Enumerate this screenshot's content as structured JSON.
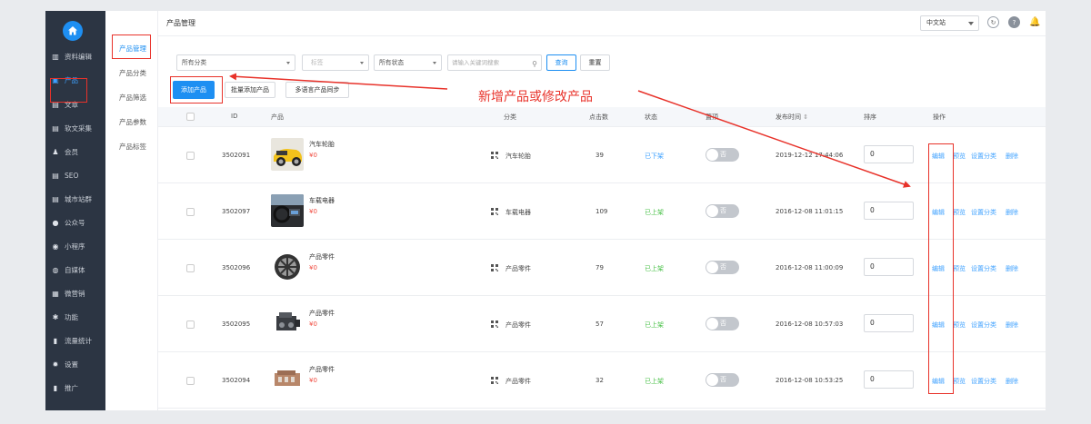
{
  "sidebar": {
    "items": [
      {
        "label": "资料编辑",
        "icon": "columns-icon",
        "active": false
      },
      {
        "label": "产品",
        "icon": "box-icon",
        "active": true
      },
      {
        "label": "文章",
        "icon": "document-icon",
        "active": false
      },
      {
        "label": "软文采集",
        "icon": "document-icon",
        "active": false
      },
      {
        "label": "会员",
        "icon": "users-icon",
        "active": false
      },
      {
        "label": "SEO",
        "icon": "document-icon",
        "active": false
      },
      {
        "label": "城市站群",
        "icon": "document-icon",
        "active": false
      },
      {
        "label": "公众号",
        "icon": "chat-icon",
        "active": false
      },
      {
        "label": "小程序",
        "icon": "compass-icon",
        "active": false
      },
      {
        "label": "自媒体",
        "icon": "media-icon",
        "active": false
      },
      {
        "label": "微营销",
        "icon": "briefcase-icon",
        "active": false
      },
      {
        "label": "功能",
        "icon": "puzzle-icon",
        "active": false
      },
      {
        "label": "流量统计",
        "icon": "bar-chart-icon",
        "active": false
      },
      {
        "label": "设置",
        "icon": "gear-icon",
        "active": false
      },
      {
        "label": "推广",
        "icon": "bar-chart-icon",
        "active": false
      }
    ]
  },
  "subnav": {
    "items": [
      {
        "label": "产品管理",
        "active": true
      },
      {
        "label": "产品分类",
        "active": false
      },
      {
        "label": "产品筛选",
        "active": false
      },
      {
        "label": "产品参数",
        "active": false
      },
      {
        "label": "产品标签",
        "active": false
      }
    ]
  },
  "header": {
    "title": "产品管理",
    "site_select": "中文站"
  },
  "filters": {
    "category": "所有分类",
    "tag": "标签",
    "status": "所有状态",
    "search_placeholder": "请输入关键词搜索",
    "query_label": "查询",
    "reset_label": "重置"
  },
  "actions": {
    "add_label": "添加产品",
    "batch_add_label": "批量添加产品",
    "multilang_label": "多语言产品同步"
  },
  "table": {
    "headers": {
      "id": "ID",
      "product": "产品",
      "category": "分类",
      "clicks": "点击数",
      "status": "状态",
      "top": "置顶",
      "publish_time": "发布时间",
      "sort": "排序",
      "ops": "操作"
    },
    "sort_arrow": "⇕",
    "op_labels": {
      "edit": "编辑",
      "preview": "预览",
      "set_category": "设置分类",
      "delete": "删除"
    },
    "rows": [
      {
        "id": "3502091",
        "name": "汽车轮胎",
        "price": "¥0",
        "category": "汽车轮胎",
        "clicks": "39",
        "status": "已下架",
        "status_type": "off",
        "top": "否",
        "time": "2019-12-12 17:44:06",
        "sort": "0",
        "thumb": "yellow-car"
      },
      {
        "id": "3502097",
        "name": "车载电器",
        "price": "¥0",
        "category": "车载电器",
        "clicks": "109",
        "status": "已上架",
        "status_type": "on",
        "top": "否",
        "time": "2016-12-08 11:01:15",
        "sort": "0",
        "thumb": "car-interior"
      },
      {
        "id": "3502096",
        "name": "产品零件",
        "price": "¥0",
        "category": "产品零件",
        "clicks": "79",
        "status": "已上架",
        "status_type": "on",
        "top": "否",
        "time": "2016-12-08 11:00:09",
        "sort": "0",
        "thumb": "rim"
      },
      {
        "id": "3502095",
        "name": "产品零件",
        "price": "¥0",
        "category": "产品零件",
        "clicks": "57",
        "status": "已上架",
        "status_type": "on",
        "top": "否",
        "time": "2016-12-08 10:57:03",
        "sort": "0",
        "thumb": "engine"
      },
      {
        "id": "3502094",
        "name": "产品零件",
        "price": "¥0",
        "category": "产品零件",
        "clicks": "32",
        "status": "已上架",
        "status_type": "on",
        "top": "否",
        "time": "2016-12-08 10:53:25",
        "sort": "0",
        "thumb": "engine-bronze"
      }
    ]
  },
  "annotation": {
    "text": "新增产品或修改产品",
    "color": "#e8322a"
  },
  "colors": {
    "accent": "#1e8ff2",
    "sidebar_bg": "#2c3543",
    "price": "#f04a3e",
    "status_on": "#4cc24b",
    "status_off": "#3ea1ff"
  }
}
